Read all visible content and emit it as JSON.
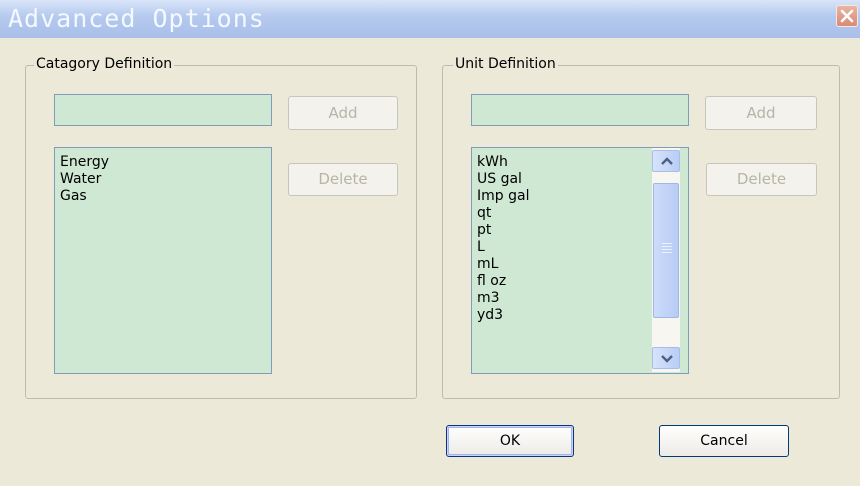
{
  "window": {
    "title": "Advanced Options",
    "close_icon": "close-icon"
  },
  "category_group": {
    "label": "Catagory Definition",
    "input_value": "",
    "add_label": "Add",
    "delete_label": "Delete",
    "items": [
      "Energy",
      "Water",
      "Gas"
    ]
  },
  "unit_group": {
    "label": "Unit Definition",
    "input_value": "",
    "add_label": "Add",
    "delete_label": "Delete",
    "items": [
      "kWh",
      "US gal",
      "Imp gal",
      "qt",
      "pt",
      "L",
      "mL",
      "fl oz",
      "m3",
      "yd3"
    ],
    "scroll_icons": [
      "chevron-up-icon",
      "chevron-down-icon"
    ]
  },
  "footer": {
    "ok_label": "OK",
    "cancel_label": "Cancel"
  },
  "colors": {
    "title_bar": "#b5c9ee",
    "list_background": "#cfe8d4",
    "dialog_background": "#ece9d8",
    "close_button": "#d98a72"
  }
}
